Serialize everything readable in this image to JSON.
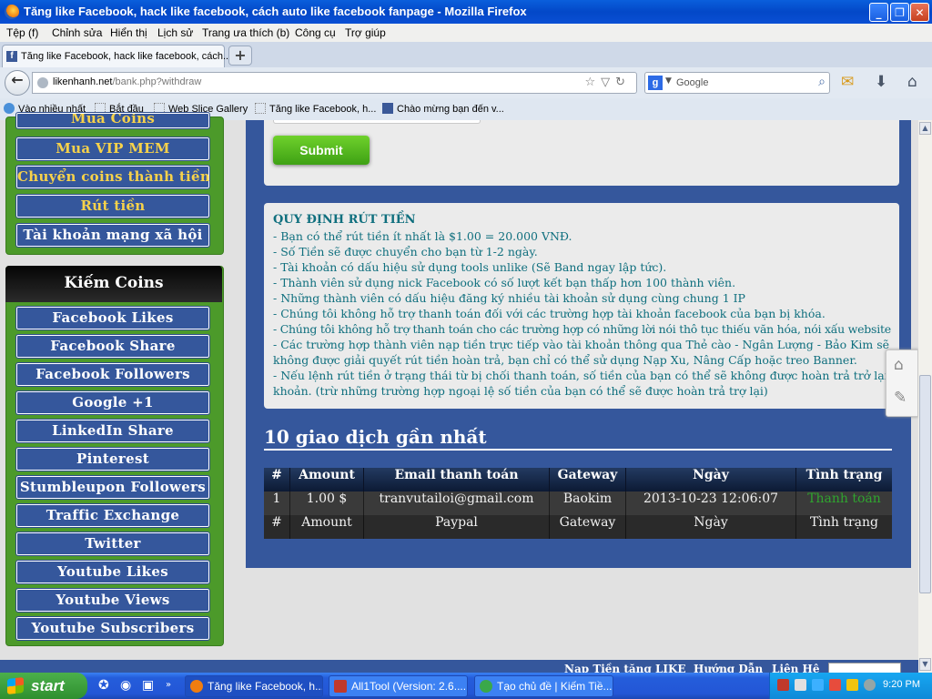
{
  "window": {
    "title": "Tăng like Facebook, hack like facebook, cách auto like facebook fanpage - Mozilla Firefox"
  },
  "menu": [
    "Tệp (f)",
    "Chỉnh sửa",
    "Hiển thị",
    "Lịch sử",
    "Trang ưa thích (b)",
    "Công cụ",
    "Trợ giúp"
  ],
  "tab": {
    "label": "Tăng like Facebook, hack like facebook, cách..."
  },
  "address": {
    "host": "likenhanh.net",
    "path": "/bank.php?withdraw"
  },
  "search": {
    "engine": "Google"
  },
  "bookmarks": [
    "Vào nhiều nhất",
    "Bắt đầu",
    "Web Slice Gallery",
    "Tăng like Facebook, h...",
    "Chào mừng bạn đến v..."
  ],
  "sidebar": {
    "top_partial": "Mua Coins",
    "account_items": [
      "Mua VIP MEM",
      "Chuyển coins thành tiền",
      "Rút tiền",
      "Tài khoản mạng xã hội"
    ],
    "earn_header": "Kiếm Coins",
    "earn_items": [
      "Facebook Likes",
      "Facebook Share",
      "Facebook Followers",
      "Google +1",
      "LinkedIn Share",
      "Pinterest",
      "Stumbleupon Followers",
      "Traffic Exchange",
      "Twitter",
      "Youtube Likes",
      "Youtube Views",
      "Youtube Subscribers"
    ]
  },
  "form": {
    "submit_label": "Submit"
  },
  "rules": {
    "heading": "QUY ĐỊNH RÚT TIỀN",
    "lines": [
      "- Bạn có thể rút tiền ít nhất là $1.00 = 20.000 VNĐ.",
      "- Số Tiền sẽ được chuyển cho bạn từ 1-2 ngày.",
      "- Tài khoản có dấu hiệu sử dụng tools unlike (Sẽ Band ngay lập tức).",
      "- Thành viên sử dụng nick Facebook có số lượt kết bạn thấp hơn 100 thành viên.",
      "- Những thành viên có dấu hiệu đăng ký nhiều tài khoản sử dụng cùng chung 1 IP",
      "- Chúng tôi không hỗ trợ thanh toán đối với các trường hợp tài khoản facebook của bạn bị khóa.",
      "- Chúng tôi không hỗ trợ thanh toán cho các trường hợp có những lời nói thô tục thiếu văn hóa, nói xấu website",
      "- Các trường hợp thành viên nạp tiền trực tiếp vào tài khoản thông qua Thẻ cào - Ngân Lượng - Bảo Kim sẽ",
      "không được giải quyết rút tiền hoàn trả, bạn chỉ có thể sử dụng Nạp Xu, Nâng Cấp hoặc treo Banner.",
      "- Nếu lệnh rút tiền ở trạng thái từ bị chối thanh toán, số tiền của bạn có thể sẽ không được hoàn trả trở lại tài",
      "khoản. (trừ những trường hợp ngoại lệ số tiền của bạn có thể sẽ được hoàn trả trợ lại)"
    ]
  },
  "transactions": {
    "title": "10 giao dịch gần nhất",
    "headers": [
      "#",
      "Amount",
      "Email thanh toán",
      "Gateway",
      "Ngày",
      "Tình trạng"
    ],
    "rows": [
      [
        "1",
        "1.00 $",
        "tranvutailoi@gmail.com",
        "Baokim",
        "2013-10-23 12:06:07",
        "Thanh toán"
      ],
      [
        "#",
        "Amount",
        "Paypal",
        "Gateway",
        "Ngày",
        "Tình trạng"
      ]
    ]
  },
  "footer": [
    "Nạp Tiền tăng LIKE",
    "Hướng Dẫn",
    "Liên Hệ"
  ],
  "taskbar": {
    "start": "start",
    "tasks": [
      "Tăng like Facebook, h...",
      "All1Tool (Version: 2.6....",
      "Tạo chủ đề | Kiếm Tiề..."
    ],
    "clock": "9:20 PM"
  }
}
